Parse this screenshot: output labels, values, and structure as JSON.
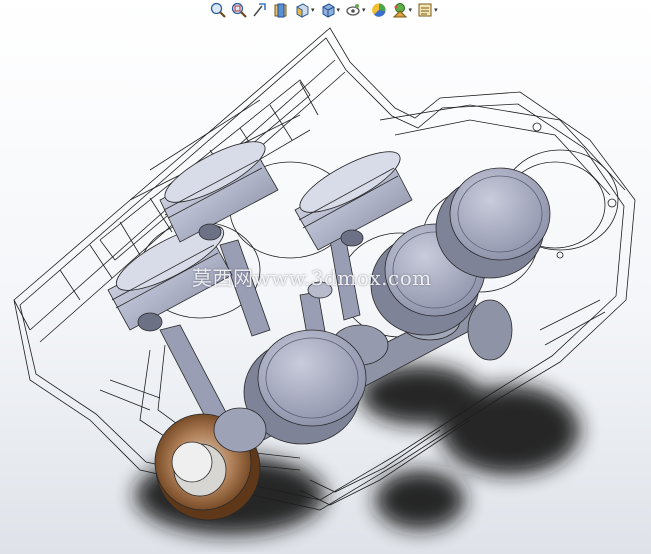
{
  "toolbar": {
    "buttons": [
      {
        "icon": "zoom-to-fit-icon",
        "has_dropdown": false
      },
      {
        "icon": "zoom-to-area-icon",
        "has_dropdown": false
      },
      {
        "icon": "previous-view-icon",
        "has_dropdown": false
      },
      {
        "icon": "section-view-icon",
        "has_dropdown": false
      },
      {
        "icon": "view-orientation-icon",
        "has_dropdown": true
      },
      {
        "icon": "display-style-icon",
        "has_dropdown": true
      },
      {
        "icon": "hide-show-items-icon",
        "has_dropdown": true
      },
      {
        "icon": "edit-appearance-icon",
        "has_dropdown": false
      },
      {
        "icon": "apply-scene-icon",
        "has_dropdown": true
      },
      {
        "icon": "view-settings-icon",
        "has_dropdown": true
      }
    ]
  },
  "colors": {
    "viewport_top": "#ffffff",
    "viewport_bottom": "#dfe3e9",
    "piston": "#a9adc6",
    "wireframe": "#1e1e1e",
    "flywheel": "#8a5a2e",
    "shadow": "#1a1a1a"
  },
  "watermark": "莫西网www.3dmox.com"
}
